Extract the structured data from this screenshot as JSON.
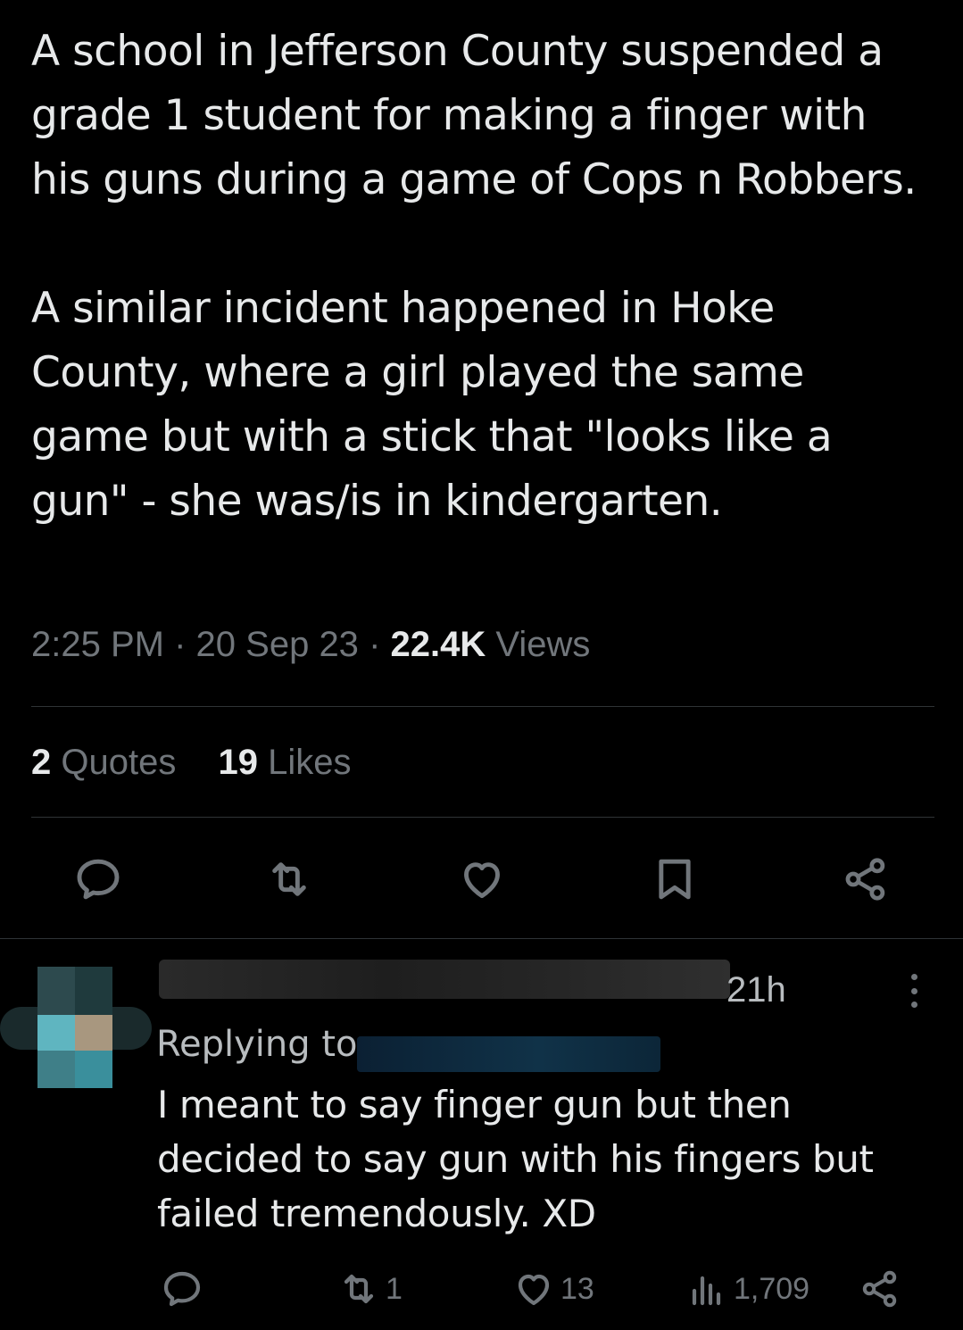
{
  "tweet": {
    "paragraphs": [
      "A school in Jefferson County suspended a grade 1 student for making a finger with his guns during a game of Cops n Robbers.",
      "A similar incident happened in Hoke County, where a girl played the same game but with a stick that \"looks like a gun\" - she was/is in kindergarten."
    ],
    "time": "2:25 PM",
    "separator": "·",
    "date": "20 Sep 23",
    "views_count": "22.4K",
    "views_label": "Views"
  },
  "stats": {
    "quotes_count": "2",
    "quotes_label": "Quotes",
    "likes_count": "19",
    "likes_label": "Likes"
  },
  "actions": {
    "icons": [
      "reply-icon",
      "retweet-icon",
      "like-icon",
      "bookmark-icon",
      "share-icon"
    ]
  },
  "reply": {
    "time": "21h",
    "replying_to": "Replying to",
    "text": "I meant to say finger gun but then decided to say gun with his fingers but failed tremendously. XD",
    "retweet_count": "1",
    "like_count": "13",
    "views_count": "1,709"
  },
  "colors": {
    "background": "#000000",
    "text": "#e7e9ea",
    "secondary": "#71767b",
    "divider": "#2f3336"
  }
}
